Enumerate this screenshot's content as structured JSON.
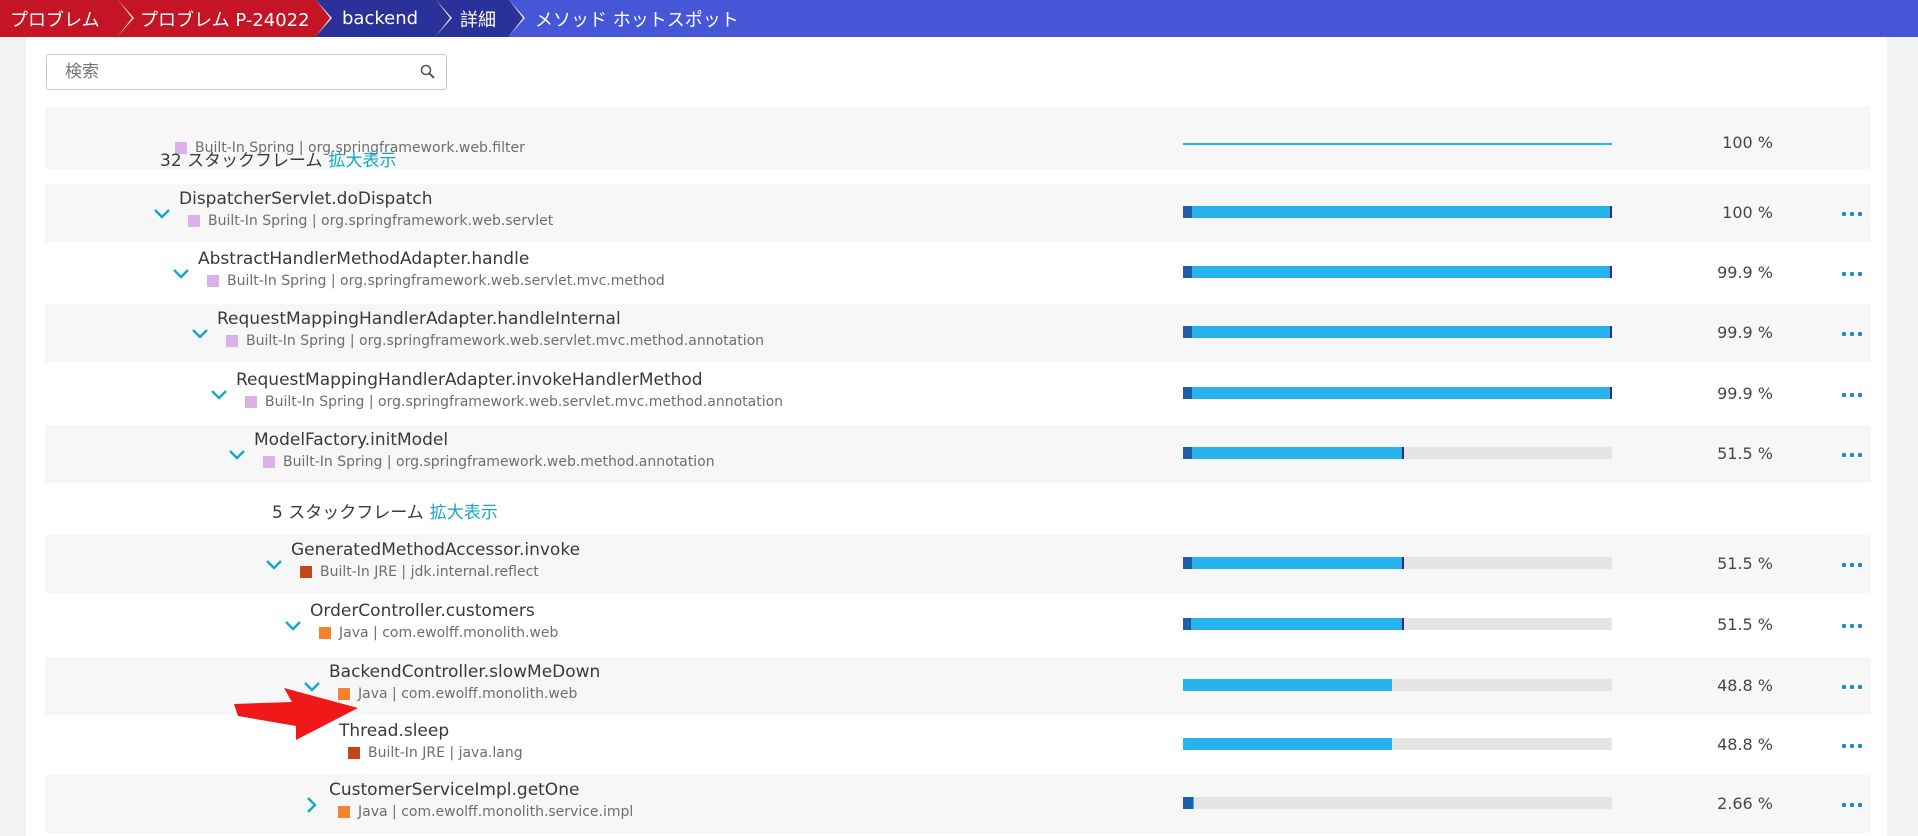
{
  "breadcrumb": [
    {
      "label": "プロブレム",
      "style": "red"
    },
    {
      "label": "プロブレム P-24022",
      "style": "red"
    },
    {
      "label": "backend",
      "style": "navy"
    },
    {
      "label": "詳細",
      "style": "navy"
    },
    {
      "label": "メソッド ホットスポット",
      "style": "blue"
    }
  ],
  "search": {
    "placeholder": "検索"
  },
  "colors": {
    "spring": "#dbb1e8",
    "jre": "#c2461c",
    "java": "#f2822e",
    "bar_fill": "#29b3ec",
    "bar_self": "#1e5ea8"
  },
  "partial_row": {
    "subtitle": "Built-In Spring | org.springframework.web.filter",
    "percent": "100 %"
  },
  "frames_32": {
    "text": "32 スタックフレーム",
    "link": "拡大表示"
  },
  "frames_5": {
    "text": "5 スタックフレーム",
    "link": "拡大表示"
  },
  "rows": [
    {
      "title": "DispatcherServlet.doDispatch",
      "subtitle": "Built-In Spring | org.springframework.web.servlet",
      "percent": "100 %",
      "value": 1.0
    },
    {
      "title": "AbstractHandlerMethodAdapter.handle",
      "subtitle": "Built-In Spring | org.springframework.web.servlet.mvc.method",
      "percent": "99.9 %",
      "value": 0.999
    },
    {
      "title": "RequestMappingHandlerAdapter.handleInternal",
      "subtitle": "Built-In Spring | org.springframework.web.servlet.mvc.method.annotation",
      "percent": "99.9 %",
      "value": 0.999
    },
    {
      "title": "RequestMappingHandlerAdapter.invokeHandlerMethod",
      "subtitle": "Built-In Spring | org.springframework.web.servlet.mvc.method.annotation",
      "percent": "99.9 %",
      "value": 0.999
    },
    {
      "title": "ModelFactory.initModel",
      "subtitle": "Built-In Spring | org.springframework.web.method.annotation",
      "percent": "51.5 %",
      "value": 0.515
    },
    {
      "title": "GeneratedMethodAccessor.invoke",
      "subtitle": "Built-In JRE | jdk.internal.reflect",
      "percent": "51.5 %",
      "value": 0.515
    },
    {
      "title": "OrderController.customers",
      "subtitle": "Java | com.ewolff.monolith.web",
      "percent": "51.5 %",
      "value": 0.515
    },
    {
      "title": "BackendController.slowMeDown",
      "subtitle": "Java | com.ewolff.monolith.web",
      "percent": "48.8 %",
      "value": 0.488
    },
    {
      "title": "Thread.sleep",
      "subtitle": "Built-In JRE | java.lang",
      "percent": "48.8 %",
      "value": 0.488
    },
    {
      "title": "CustomerServiceImpl.getOne",
      "subtitle": "Java | com.ewolff.monolith.service.impl",
      "percent": "2.66 %",
      "value": 0.0266
    }
  ]
}
